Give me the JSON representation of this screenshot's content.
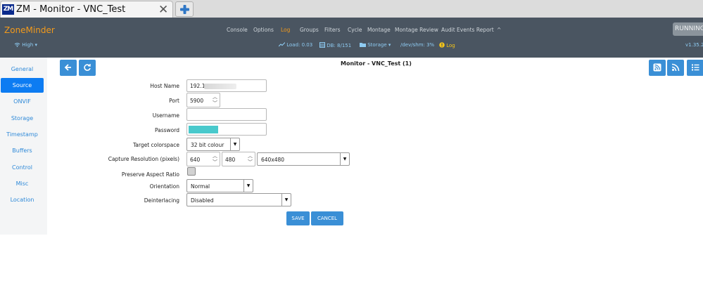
{
  "browser": {
    "tab_title": "ZM - Monitor - VNC_Test",
    "favicon_text": "ZM",
    "close_glyph": "✕",
    "new_tab_icon": "plus-icon"
  },
  "header": {
    "brand": "ZoneMinder",
    "nav": [
      "Console",
      "Options",
      "Log",
      "Groups",
      "Filters",
      "Cycle",
      "Montage",
      "Montage Review",
      "Audit Events Report"
    ],
    "active_nav": "Log",
    "collapse_glyph": "^",
    "running": "RUNNING",
    "bandwidth": "High ▾",
    "load": "Load: 0.03",
    "db": "DB: 8/151",
    "storage": "Storage ▾",
    "shm": "/dev/shm: 3%",
    "log": "Log",
    "version": "v1.35.2",
    "colors": {
      "bar": "#4a5561",
      "brand": "#f39a1b",
      "status": "#8ecbf2",
      "warn": "#f5c518"
    }
  },
  "sidebar": {
    "items": [
      "General",
      "Source",
      "ONVIF",
      "Storage",
      "Timestamp",
      "Buffers",
      "Control",
      "Misc",
      "Location"
    ],
    "active": "Source"
  },
  "page": {
    "title": "Monitor - VNC_Test (1)"
  },
  "form": {
    "host_name": {
      "label": "Host Name",
      "value": "192.16"
    },
    "port": {
      "label": "Port",
      "value": "5900"
    },
    "username": {
      "label": "Username",
      "value": ""
    },
    "password": {
      "label": "Password",
      "value": ""
    },
    "colorspace": {
      "label": "Target colorspace",
      "value": "32 bit colour"
    },
    "capture": {
      "label": "Capture Resolution (pixels)",
      "width": "640",
      "height": "480",
      "preset": "640x480"
    },
    "aspect": {
      "label": "Preserve Aspect Ratio",
      "checked": false
    },
    "orientation": {
      "label": "Orientation",
      "value": "Normal"
    },
    "deinterlacing": {
      "label": "Deinterlacing",
      "value": "Disabled"
    }
  },
  "buttons": {
    "save": "SAVE",
    "cancel": "CANCEL"
  }
}
